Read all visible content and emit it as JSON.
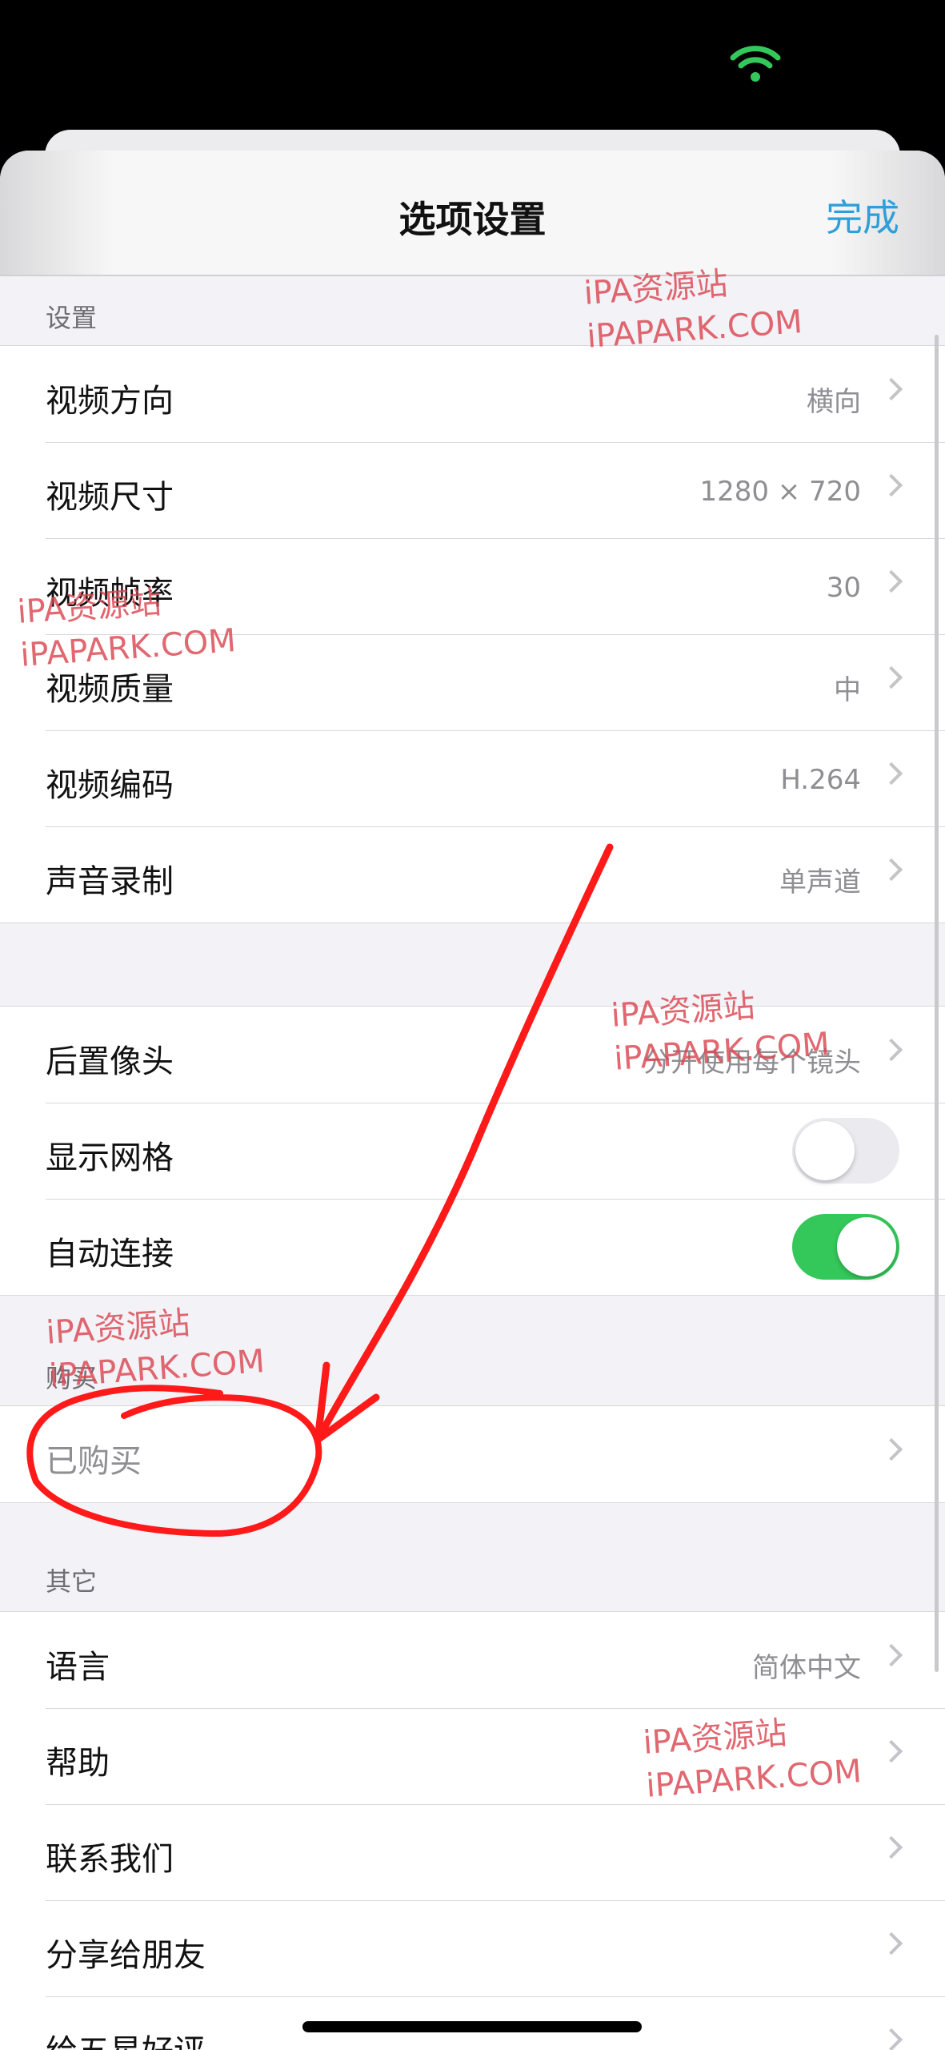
{
  "nav": {
    "title": "选项设置",
    "done_label": "完成"
  },
  "sections": {
    "settings_header": "设置",
    "settings_rows": [
      {
        "label": "视频方向",
        "value": "横向"
      },
      {
        "label": "视频尺寸",
        "value": "1280 × 720"
      },
      {
        "label": "视频帧率",
        "value": "30"
      },
      {
        "label": "视频质量",
        "value": "中"
      },
      {
        "label": "视频编码",
        "value": "H.264"
      },
      {
        "label": "声音录制",
        "value": "单声道"
      }
    ],
    "camera_rows": [
      {
        "label": "后置像头",
        "value": "分开使用每个镜头"
      },
      {
        "label": "显示网格",
        "toggle": "off"
      },
      {
        "label": "自动连接",
        "toggle": "on"
      }
    ],
    "purchase_header": "购买",
    "purchase_rows": [
      {
        "label": "已购买"
      }
    ],
    "other_header": "其它",
    "other_rows": [
      {
        "label": "语言",
        "value": "简体中文"
      },
      {
        "label": "帮助"
      },
      {
        "label": "联系我们"
      },
      {
        "label": "分享给朋友"
      },
      {
        "label": "给五星好评"
      }
    ]
  },
  "watermarks": [
    {
      "line1": "iPA资源站",
      "line2": "iPAPARK.COM"
    },
    {
      "line1": "iPA资源站",
      "line2": "iPAPARK.COM"
    },
    {
      "line1": "iPA资源站",
      "line2": "iPAPARK.COM"
    },
    {
      "line1": "iPA资源站",
      "line2": "iPAPARK.COM"
    },
    {
      "line1": "iPA资源站",
      "line2": "iPAPARK.COM"
    }
  ],
  "colors": {
    "accent": "#2f9fd9",
    "toggle_on": "#34c759",
    "annotation": "#ff1a1a",
    "watermark": "#da4650"
  },
  "icons": {
    "wifi": "wifi-icon",
    "chevron": "chevron-right-icon"
  }
}
